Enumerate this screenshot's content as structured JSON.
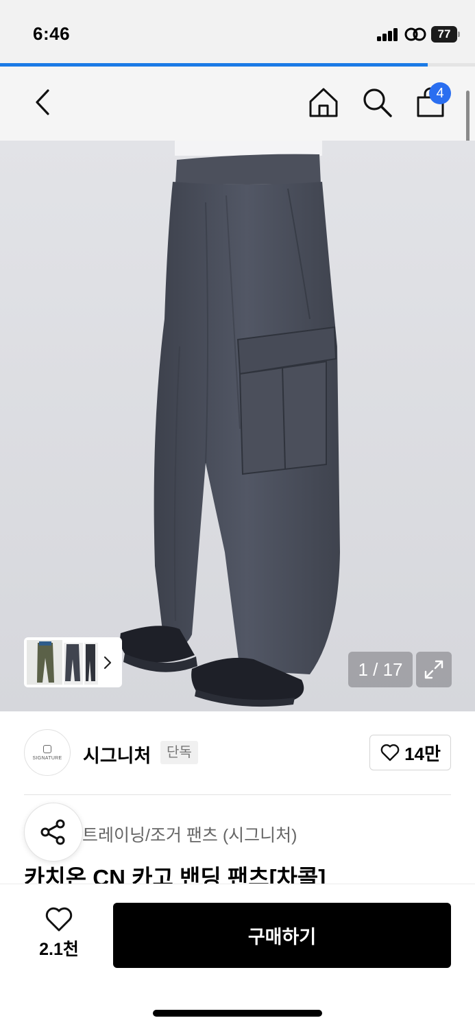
{
  "status_bar": {
    "time": "6:46",
    "battery": "77",
    "icons": [
      "cellular-signal-icon",
      "link-icon",
      "battery-icon"
    ]
  },
  "load_progress": 0.9,
  "header": {
    "icons": [
      "back-icon",
      "home-icon",
      "search-icon",
      "cart-icon"
    ],
    "cart_count": "4"
  },
  "gallery": {
    "counter": "1 / 17",
    "icons": [
      "chevron-right-icon",
      "expand-icon"
    ]
  },
  "brand": {
    "logo_text": "SIGNATURE",
    "name": "시그니처",
    "tag": "단독",
    "likes": "14만",
    "icons": [
      "heart-icon"
    ]
  },
  "product": {
    "category": "트레이닝/조거 팬츠 (시그니처)",
    "title": "카치온 CN 카고 밴딩 팬츠[차콜]",
    "icons": [
      "share-icon"
    ]
  },
  "bottom_bar": {
    "wish_count": "2.1천",
    "buy_label": "구매하기",
    "icons": [
      "heart-icon"
    ]
  },
  "colors": {
    "accent_blue": "#2a6ef0",
    "progress_blue": "#1b7ae6",
    "pants_charcoal": "#4a4f5c",
    "background_gray": "#dcdde1",
    "buy_button": "#000000"
  }
}
